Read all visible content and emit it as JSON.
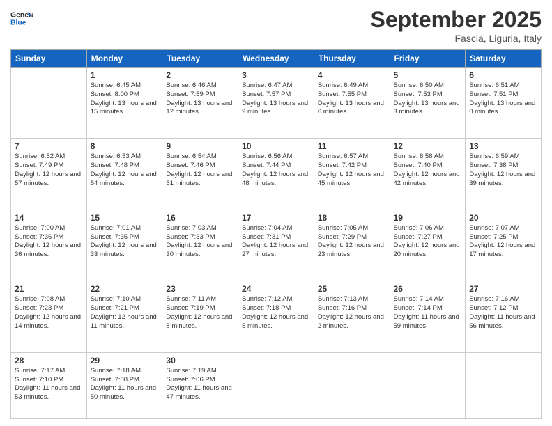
{
  "header": {
    "logo_general": "General",
    "logo_blue": "Blue",
    "month_title": "September 2025",
    "location": "Fascia, Liguria, Italy"
  },
  "days_of_week": [
    "Sunday",
    "Monday",
    "Tuesday",
    "Wednesday",
    "Thursday",
    "Friday",
    "Saturday"
  ],
  "weeks": [
    [
      {
        "day": "",
        "info": ""
      },
      {
        "day": "1",
        "info": "Sunrise: 6:45 AM\nSunset: 8:00 PM\nDaylight: 13 hours\nand 15 minutes."
      },
      {
        "day": "2",
        "info": "Sunrise: 6:46 AM\nSunset: 7:59 PM\nDaylight: 13 hours\nand 12 minutes."
      },
      {
        "day": "3",
        "info": "Sunrise: 6:47 AM\nSunset: 7:57 PM\nDaylight: 13 hours\nand 9 minutes."
      },
      {
        "day": "4",
        "info": "Sunrise: 6:49 AM\nSunset: 7:55 PM\nDaylight: 13 hours\nand 6 minutes."
      },
      {
        "day": "5",
        "info": "Sunrise: 6:50 AM\nSunset: 7:53 PM\nDaylight: 13 hours\nand 3 minutes."
      },
      {
        "day": "6",
        "info": "Sunrise: 6:51 AM\nSunset: 7:51 PM\nDaylight: 13 hours\nand 0 minutes."
      }
    ],
    [
      {
        "day": "7",
        "info": "Sunrise: 6:52 AM\nSunset: 7:49 PM\nDaylight: 12 hours\nand 57 minutes."
      },
      {
        "day": "8",
        "info": "Sunrise: 6:53 AM\nSunset: 7:48 PM\nDaylight: 12 hours\nand 54 minutes."
      },
      {
        "day": "9",
        "info": "Sunrise: 6:54 AM\nSunset: 7:46 PM\nDaylight: 12 hours\nand 51 minutes."
      },
      {
        "day": "10",
        "info": "Sunrise: 6:56 AM\nSunset: 7:44 PM\nDaylight: 12 hours\nand 48 minutes."
      },
      {
        "day": "11",
        "info": "Sunrise: 6:57 AM\nSunset: 7:42 PM\nDaylight: 12 hours\nand 45 minutes."
      },
      {
        "day": "12",
        "info": "Sunrise: 6:58 AM\nSunset: 7:40 PM\nDaylight: 12 hours\nand 42 minutes."
      },
      {
        "day": "13",
        "info": "Sunrise: 6:59 AM\nSunset: 7:38 PM\nDaylight: 12 hours\nand 39 minutes."
      }
    ],
    [
      {
        "day": "14",
        "info": "Sunrise: 7:00 AM\nSunset: 7:36 PM\nDaylight: 12 hours\nand 36 minutes."
      },
      {
        "day": "15",
        "info": "Sunrise: 7:01 AM\nSunset: 7:35 PM\nDaylight: 12 hours\nand 33 minutes."
      },
      {
        "day": "16",
        "info": "Sunrise: 7:03 AM\nSunset: 7:33 PM\nDaylight: 12 hours\nand 30 minutes."
      },
      {
        "day": "17",
        "info": "Sunrise: 7:04 AM\nSunset: 7:31 PM\nDaylight: 12 hours\nand 27 minutes."
      },
      {
        "day": "18",
        "info": "Sunrise: 7:05 AM\nSunset: 7:29 PM\nDaylight: 12 hours\nand 23 minutes."
      },
      {
        "day": "19",
        "info": "Sunrise: 7:06 AM\nSunset: 7:27 PM\nDaylight: 12 hours\nand 20 minutes."
      },
      {
        "day": "20",
        "info": "Sunrise: 7:07 AM\nSunset: 7:25 PM\nDaylight: 12 hours\nand 17 minutes."
      }
    ],
    [
      {
        "day": "21",
        "info": "Sunrise: 7:08 AM\nSunset: 7:23 PM\nDaylight: 12 hours\nand 14 minutes."
      },
      {
        "day": "22",
        "info": "Sunrise: 7:10 AM\nSunset: 7:21 PM\nDaylight: 12 hours\nand 11 minutes."
      },
      {
        "day": "23",
        "info": "Sunrise: 7:11 AM\nSunset: 7:19 PM\nDaylight: 12 hours\nand 8 minutes."
      },
      {
        "day": "24",
        "info": "Sunrise: 7:12 AM\nSunset: 7:18 PM\nDaylight: 12 hours\nand 5 minutes."
      },
      {
        "day": "25",
        "info": "Sunrise: 7:13 AM\nSunset: 7:16 PM\nDaylight: 12 hours\nand 2 minutes."
      },
      {
        "day": "26",
        "info": "Sunrise: 7:14 AM\nSunset: 7:14 PM\nDaylight: 11 hours\nand 59 minutes."
      },
      {
        "day": "27",
        "info": "Sunrise: 7:16 AM\nSunset: 7:12 PM\nDaylight: 11 hours\nand 56 minutes."
      }
    ],
    [
      {
        "day": "28",
        "info": "Sunrise: 7:17 AM\nSunset: 7:10 PM\nDaylight: 11 hours\nand 53 minutes."
      },
      {
        "day": "29",
        "info": "Sunrise: 7:18 AM\nSunset: 7:08 PM\nDaylight: 11 hours\nand 50 minutes."
      },
      {
        "day": "30",
        "info": "Sunrise: 7:19 AM\nSunset: 7:06 PM\nDaylight: 11 hours\nand 47 minutes."
      },
      {
        "day": "",
        "info": ""
      },
      {
        "day": "",
        "info": ""
      },
      {
        "day": "",
        "info": ""
      },
      {
        "day": "",
        "info": ""
      }
    ]
  ]
}
